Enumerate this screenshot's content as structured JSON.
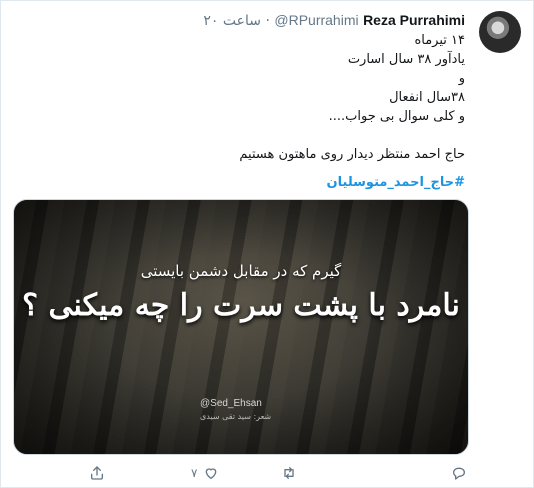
{
  "tweet": {
    "author_name": "Reza Purrahimi",
    "handle": "@RPurrahimi",
    "time": "۲۰ ساعت",
    "separator": "·",
    "lines": [
      "۱۴ تیرماه",
      "یادآور ۳۸ سال اسارت",
      "و",
      "۳۸سال انفعال",
      "و کلی سوال بی جواب....",
      "",
      "حاج احمد منتظر دیدار روی ماهتون هستیم"
    ],
    "hashtag": "#حاج_احمد_متوسلیان"
  },
  "media": {
    "caption_line1": "گیرم که در مقابل دشمن بایستی",
    "caption_line2": "نامرد با پشت سرت را چه میکنی ؟",
    "watermark": "@Sed_Ehsan",
    "credit": "شعر: سید تقی سیدی"
  },
  "actions": {
    "like_count": "۷",
    "reply_icon": "reply-icon",
    "retweet_icon": "retweet-icon",
    "like_icon": "heart-icon",
    "share_icon": "share-icon"
  }
}
